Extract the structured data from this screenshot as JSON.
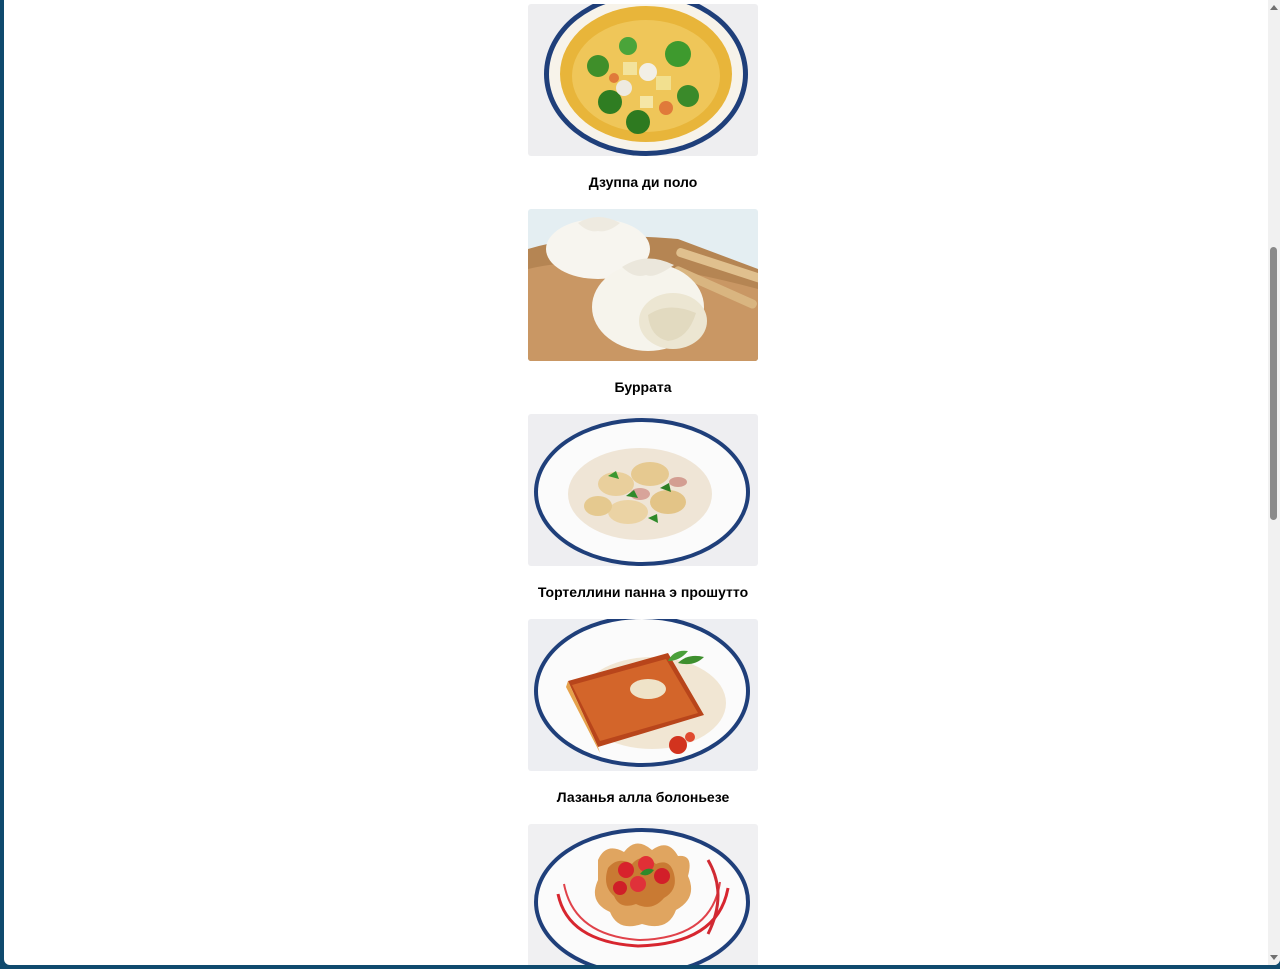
{
  "menu": {
    "dishes": [
      {
        "name": "",
        "image": "chicken-vegetable-soup-photo"
      },
      {
        "name": "Дзуппа ди поло",
        "image": "burrata-cheese-photo"
      },
      {
        "name": "Буррата",
        "image": "tortellini-plate-photo"
      },
      {
        "name": "Тортеллини панна э прошутто",
        "image": "lasagna-plate-photo"
      },
      {
        "name": "Лазанья алла болоньезе",
        "image": "strawberry-dessert-photo"
      }
    ]
  },
  "colors": {
    "desktop_background": "#0f4a6e",
    "page_background": "#ffffff",
    "plate_rim": "#1f3f7a"
  },
  "scrollbar": {
    "up_icon": "scroll-up-arrow-icon",
    "down_icon": "scroll-down-arrow-icon"
  }
}
